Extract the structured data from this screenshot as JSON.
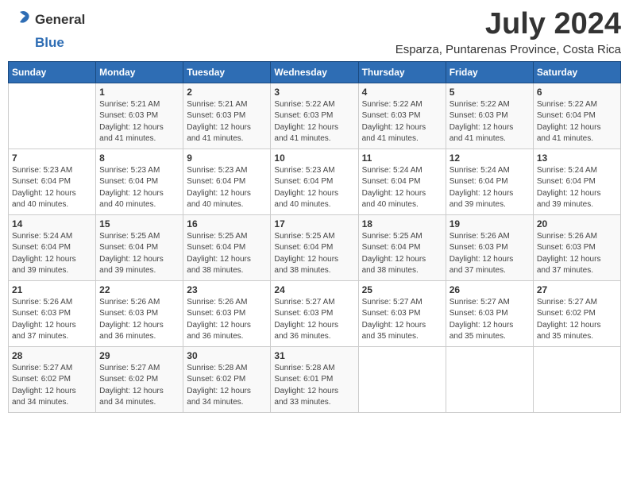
{
  "logo": {
    "general": "General",
    "blue": "Blue"
  },
  "title": "July 2024",
  "subtitle": "Esparza, Puntarenas Province, Costa Rica",
  "days_header": [
    "Sunday",
    "Monday",
    "Tuesday",
    "Wednesday",
    "Thursday",
    "Friday",
    "Saturday"
  ],
  "weeks": [
    [
      {
        "day": "",
        "detail": ""
      },
      {
        "day": "1",
        "detail": "Sunrise: 5:21 AM\nSunset: 6:03 PM\nDaylight: 12 hours\nand 41 minutes."
      },
      {
        "day": "2",
        "detail": "Sunrise: 5:21 AM\nSunset: 6:03 PM\nDaylight: 12 hours\nand 41 minutes."
      },
      {
        "day": "3",
        "detail": "Sunrise: 5:22 AM\nSunset: 6:03 PM\nDaylight: 12 hours\nand 41 minutes."
      },
      {
        "day": "4",
        "detail": "Sunrise: 5:22 AM\nSunset: 6:03 PM\nDaylight: 12 hours\nand 41 minutes."
      },
      {
        "day": "5",
        "detail": "Sunrise: 5:22 AM\nSunset: 6:03 PM\nDaylight: 12 hours\nand 41 minutes."
      },
      {
        "day": "6",
        "detail": "Sunrise: 5:22 AM\nSunset: 6:04 PM\nDaylight: 12 hours\nand 41 minutes."
      }
    ],
    [
      {
        "day": "7",
        "detail": "Sunrise: 5:23 AM\nSunset: 6:04 PM\nDaylight: 12 hours\nand 40 minutes."
      },
      {
        "day": "8",
        "detail": "Sunrise: 5:23 AM\nSunset: 6:04 PM\nDaylight: 12 hours\nand 40 minutes."
      },
      {
        "day": "9",
        "detail": "Sunrise: 5:23 AM\nSunset: 6:04 PM\nDaylight: 12 hours\nand 40 minutes."
      },
      {
        "day": "10",
        "detail": "Sunrise: 5:23 AM\nSunset: 6:04 PM\nDaylight: 12 hours\nand 40 minutes."
      },
      {
        "day": "11",
        "detail": "Sunrise: 5:24 AM\nSunset: 6:04 PM\nDaylight: 12 hours\nand 40 minutes."
      },
      {
        "day": "12",
        "detail": "Sunrise: 5:24 AM\nSunset: 6:04 PM\nDaylight: 12 hours\nand 39 minutes."
      },
      {
        "day": "13",
        "detail": "Sunrise: 5:24 AM\nSunset: 6:04 PM\nDaylight: 12 hours\nand 39 minutes."
      }
    ],
    [
      {
        "day": "14",
        "detail": "Sunrise: 5:24 AM\nSunset: 6:04 PM\nDaylight: 12 hours\nand 39 minutes."
      },
      {
        "day": "15",
        "detail": "Sunrise: 5:25 AM\nSunset: 6:04 PM\nDaylight: 12 hours\nand 39 minutes."
      },
      {
        "day": "16",
        "detail": "Sunrise: 5:25 AM\nSunset: 6:04 PM\nDaylight: 12 hours\nand 38 minutes."
      },
      {
        "day": "17",
        "detail": "Sunrise: 5:25 AM\nSunset: 6:04 PM\nDaylight: 12 hours\nand 38 minutes."
      },
      {
        "day": "18",
        "detail": "Sunrise: 5:25 AM\nSunset: 6:04 PM\nDaylight: 12 hours\nand 38 minutes."
      },
      {
        "day": "19",
        "detail": "Sunrise: 5:26 AM\nSunset: 6:03 PM\nDaylight: 12 hours\nand 37 minutes."
      },
      {
        "day": "20",
        "detail": "Sunrise: 5:26 AM\nSunset: 6:03 PM\nDaylight: 12 hours\nand 37 minutes."
      }
    ],
    [
      {
        "day": "21",
        "detail": "Sunrise: 5:26 AM\nSunset: 6:03 PM\nDaylight: 12 hours\nand 37 minutes."
      },
      {
        "day": "22",
        "detail": "Sunrise: 5:26 AM\nSunset: 6:03 PM\nDaylight: 12 hours\nand 36 minutes."
      },
      {
        "day": "23",
        "detail": "Sunrise: 5:26 AM\nSunset: 6:03 PM\nDaylight: 12 hours\nand 36 minutes."
      },
      {
        "day": "24",
        "detail": "Sunrise: 5:27 AM\nSunset: 6:03 PM\nDaylight: 12 hours\nand 36 minutes."
      },
      {
        "day": "25",
        "detail": "Sunrise: 5:27 AM\nSunset: 6:03 PM\nDaylight: 12 hours\nand 35 minutes."
      },
      {
        "day": "26",
        "detail": "Sunrise: 5:27 AM\nSunset: 6:03 PM\nDaylight: 12 hours\nand 35 minutes."
      },
      {
        "day": "27",
        "detail": "Sunrise: 5:27 AM\nSunset: 6:02 PM\nDaylight: 12 hours\nand 35 minutes."
      }
    ],
    [
      {
        "day": "28",
        "detail": "Sunrise: 5:27 AM\nSunset: 6:02 PM\nDaylight: 12 hours\nand 34 minutes."
      },
      {
        "day": "29",
        "detail": "Sunrise: 5:27 AM\nSunset: 6:02 PM\nDaylight: 12 hours\nand 34 minutes."
      },
      {
        "day": "30",
        "detail": "Sunrise: 5:28 AM\nSunset: 6:02 PM\nDaylight: 12 hours\nand 34 minutes."
      },
      {
        "day": "31",
        "detail": "Sunrise: 5:28 AM\nSunset: 6:01 PM\nDaylight: 12 hours\nand 33 minutes."
      },
      {
        "day": "",
        "detail": ""
      },
      {
        "day": "",
        "detail": ""
      },
      {
        "day": "",
        "detail": ""
      }
    ]
  ]
}
